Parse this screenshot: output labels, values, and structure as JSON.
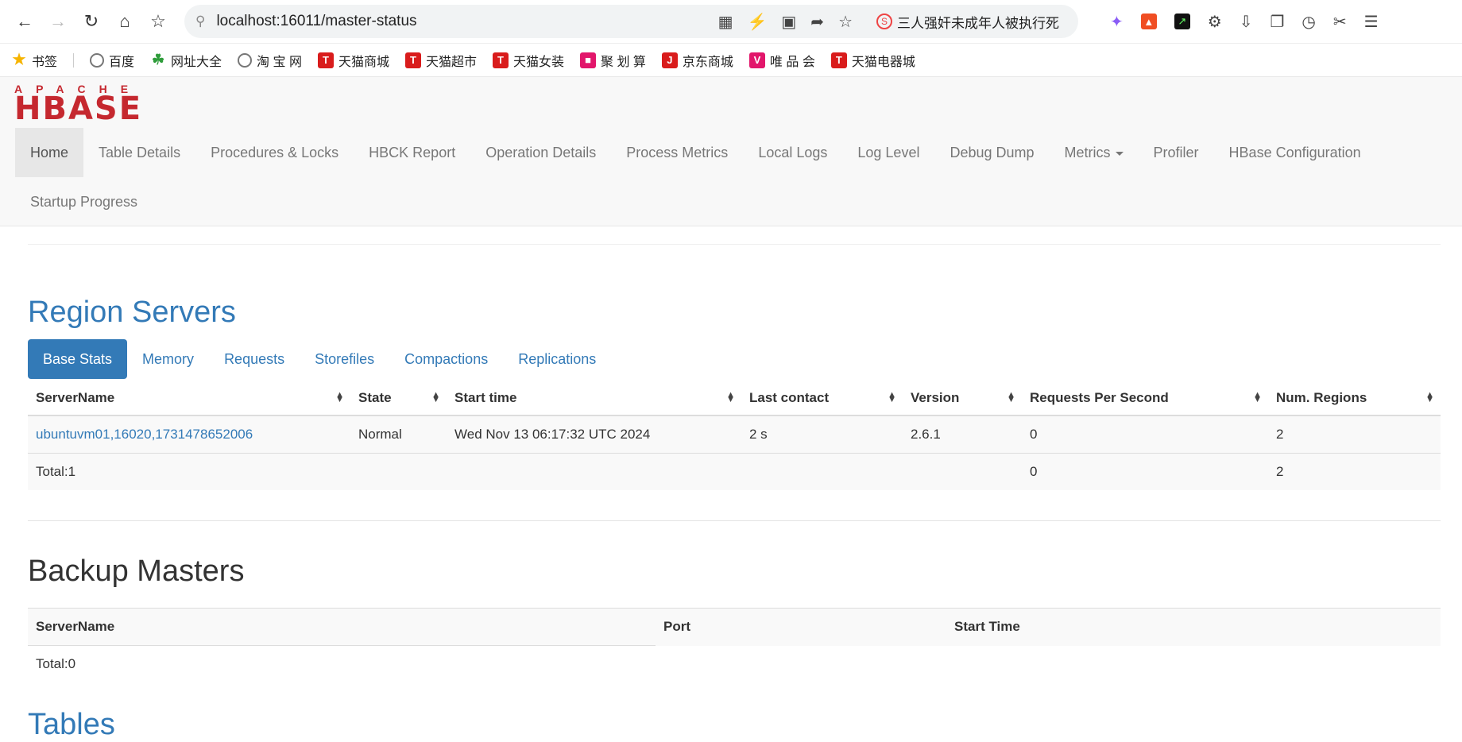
{
  "browser": {
    "url": "localhost:16011/master-status",
    "news_headline": "三人强奸未成年人被执行死"
  },
  "bookmarks": [
    {
      "label": "书签"
    },
    {
      "label": "百度"
    },
    {
      "label": "网址大全"
    },
    {
      "label": "淘 宝 网"
    },
    {
      "label": "天猫商城"
    },
    {
      "label": "天猫超市"
    },
    {
      "label": "天猫女装"
    },
    {
      "label": "聚 划 算"
    },
    {
      "label": "京东商城"
    },
    {
      "label": "唯 品 会"
    },
    {
      "label": "天猫电器城"
    }
  ],
  "logo": {
    "top": "APACHE",
    "main": "HBASE"
  },
  "nav": {
    "items": [
      "Home",
      "Table Details",
      "Procedures & Locks",
      "HBCK Report",
      "Operation Details",
      "Process Metrics",
      "Local Logs",
      "Log Level",
      "Debug Dump",
      "Metrics",
      "Profiler",
      "HBase Configuration",
      "Startup Progress"
    ]
  },
  "region_servers": {
    "title": "Region Servers",
    "tabs": [
      "Base Stats",
      "Memory",
      "Requests",
      "Storefiles",
      "Compactions",
      "Replications"
    ],
    "columns": [
      "ServerName",
      "State",
      "Start time",
      "Last contact",
      "Version",
      "Requests Per Second",
      "Num. Regions"
    ],
    "rows": [
      [
        "ubuntuvm01,16020,1731478652006",
        "Normal",
        "Wed Nov 13 06:17:32 UTC 2024",
        "2 s",
        "2.6.1",
        "0",
        "2"
      ]
    ],
    "total": {
      "label": "Total:1",
      "requests": "0",
      "regions": "2"
    }
  },
  "backup_masters": {
    "title": "Backup Masters",
    "columns": [
      "ServerName",
      "Port",
      "Start Time"
    ],
    "total": "Total:0"
  },
  "tables": {
    "title": "Tables"
  }
}
